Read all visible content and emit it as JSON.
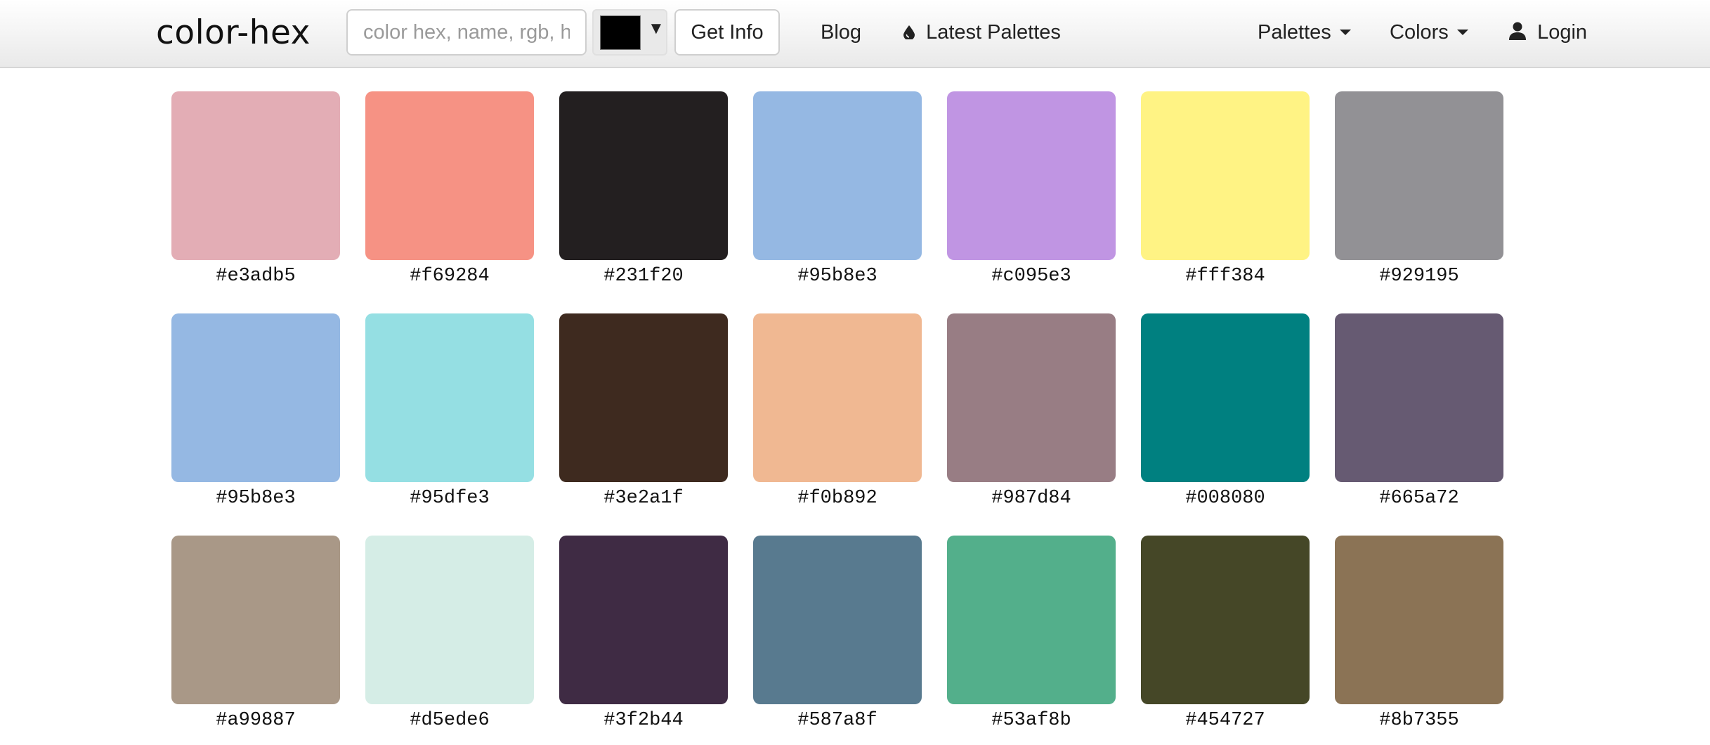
{
  "navbar": {
    "brand": "color-hex",
    "search_placeholder": "color hex, name, rgb, hsl",
    "picker_color": "#000000",
    "picker_arrow": "▼",
    "get_info_label": "Get Info",
    "blog_label": "Blog",
    "latest_palettes_label": "Latest Palettes",
    "palettes_label": "Palettes",
    "colors_label": "Colors",
    "login_label": "Login"
  },
  "colors": [
    {
      "hex": "#e3adb5"
    },
    {
      "hex": "#f69284"
    },
    {
      "hex": "#231f20"
    },
    {
      "hex": "#95b8e3"
    },
    {
      "hex": "#c095e3"
    },
    {
      "hex": "#fff384"
    },
    {
      "hex": "#929195"
    },
    {
      "hex": "#95b8e3"
    },
    {
      "hex": "#95dfe3"
    },
    {
      "hex": "#3e2a1f"
    },
    {
      "hex": "#f0b892"
    },
    {
      "hex": "#987d84"
    },
    {
      "hex": "#008080"
    },
    {
      "hex": "#665a72"
    },
    {
      "hex": "#a99887"
    },
    {
      "hex": "#d5ede6"
    },
    {
      "hex": "#3f2b44"
    },
    {
      "hex": "#587a8f"
    },
    {
      "hex": "#53af8b"
    },
    {
      "hex": "#454727"
    },
    {
      "hex": "#8b7355"
    }
  ]
}
